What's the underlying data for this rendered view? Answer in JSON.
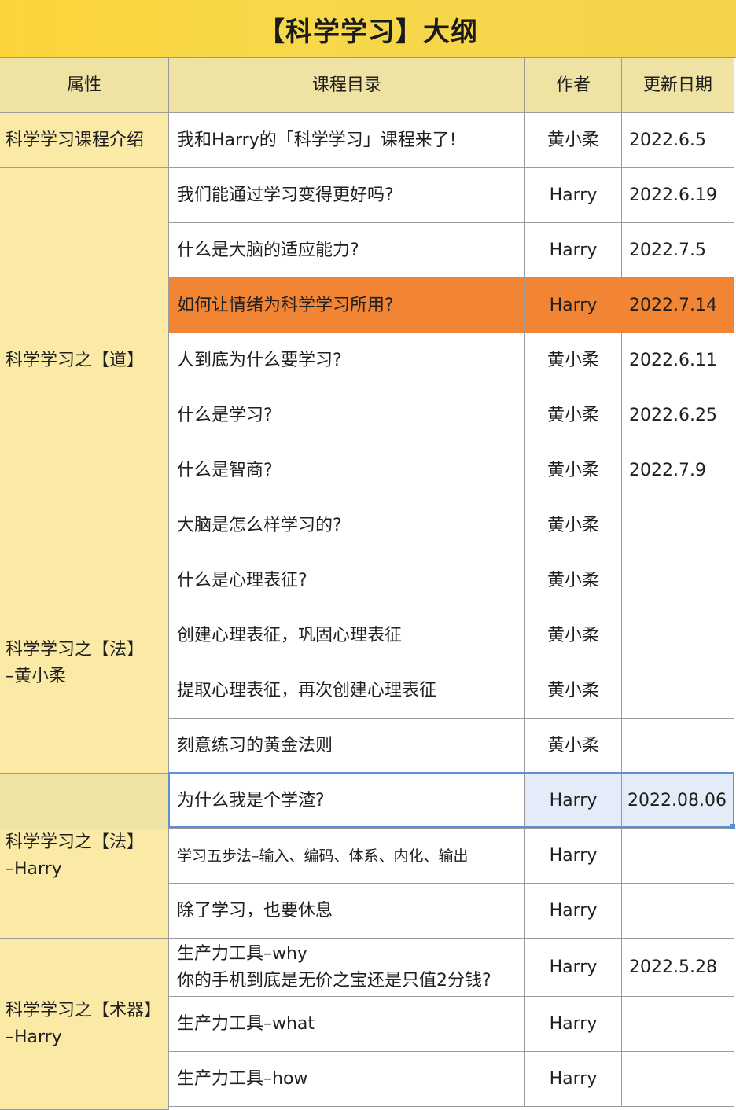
{
  "title": "【科学学习】大纲",
  "headers": {
    "attr": "属性",
    "course": "课程目录",
    "author": "作者",
    "date": "更新日期"
  },
  "groups": [
    {
      "label_lines": [
        "科学学习课程介绍"
      ]
    },
    {
      "label_lines": [
        "科学学习之【道】"
      ]
    },
    {
      "label_lines": [
        "科学学习之【法】",
        "–黄小柔"
      ]
    },
    {
      "label_lines": [
        "科学学习之【法】",
        "–Harry"
      ]
    },
    {
      "label_lines": [
        "科学学习之【术器】",
        "–Harry"
      ]
    }
  ],
  "rows": [
    {
      "course": "我和Harry的「科学学习」课程来了!",
      "author": "黄小柔",
      "date": "2022.6.5"
    },
    {
      "course": "我们能通过学习变得更好吗?",
      "author": "Harry",
      "date": "2022.6.19"
    },
    {
      "course": "什么是大脑的适应能力?",
      "author": "Harry",
      "date": "2022.7.5"
    },
    {
      "course": "如何让情绪为科学学习所用?",
      "author": "Harry",
      "date": "2022.7.14"
    },
    {
      "course": "人到底为什么要学习?",
      "author": "黄小柔",
      "date": "2022.6.11"
    },
    {
      "course": "什么是学习?",
      "author": "黄小柔",
      "date": "2022.6.25"
    },
    {
      "course": "什么是智商?",
      "author": "黄小柔",
      "date": "2022.7.9"
    },
    {
      "course": "大脑是怎么样学习的?",
      "author": "黄小柔",
      "date": ""
    },
    {
      "course": "什么是心理表征?",
      "author": "黄小柔",
      "date": ""
    },
    {
      "course": "创建心理表征，巩固心理表征",
      "author": "黄小柔",
      "date": ""
    },
    {
      "course": "提取心理表征，再次创建心理表征",
      "author": "黄小柔",
      "date": ""
    },
    {
      "course": "刻意练习的黄金法则",
      "author": "黄小柔",
      "date": ""
    },
    {
      "course": "为什么我是个学渣?",
      "author": "Harry",
      "date": "2022.08.06"
    },
    {
      "course": "学习五步法–输入、编码、体系、内化、输出",
      "author": "Harry",
      "date": ""
    },
    {
      "course": "除了学习，也要休息",
      "author": "Harry",
      "date": ""
    },
    {
      "course_lines": [
        "生产力工具–why",
        "你的手机到底是无价之宝还是只值2分钱?"
      ],
      "author": "Harry",
      "date": "2022.5.28"
    },
    {
      "course": "生产力工具–what",
      "author": "Harry",
      "date": ""
    },
    {
      "course": "生产力工具–how",
      "author": "Harry",
      "date": ""
    }
  ],
  "colors": {
    "title_bg": "#f7d84a",
    "header_bg": "#efe3a3",
    "attr_bg": "#fbe9a6",
    "highlight_row": "#f28534",
    "selection": "#5b8fd6",
    "selected_cell_bg": "#e3ecf8"
  }
}
